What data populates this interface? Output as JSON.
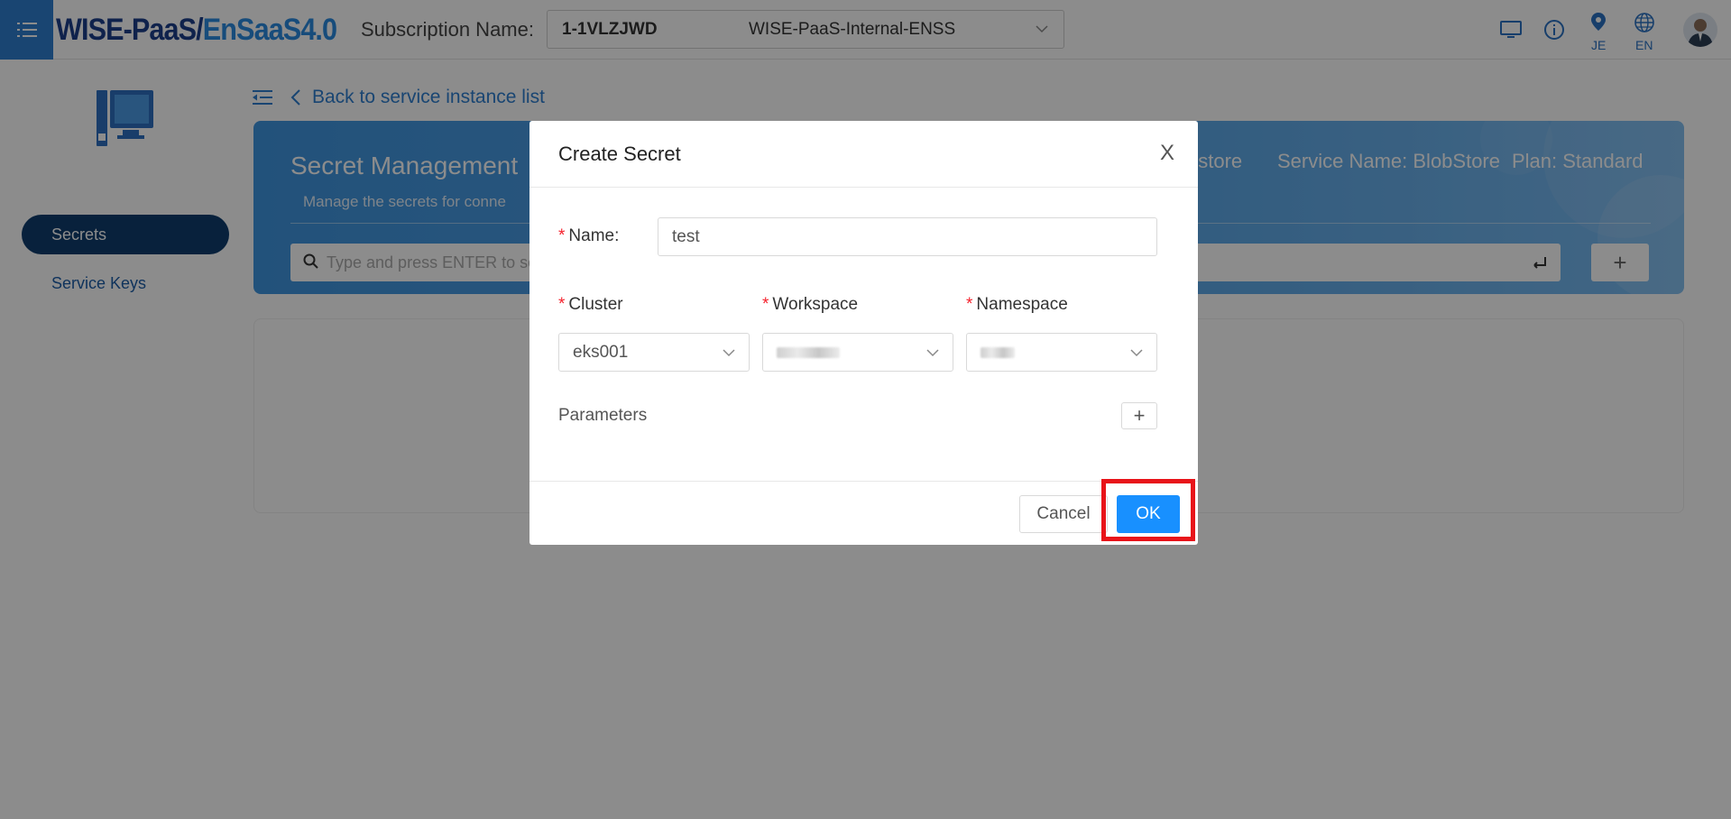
{
  "header": {
    "logo_part1": "WISE-PaaS/",
    "logo_part2": "EnSaaS4.0",
    "subscription_label": "Subscription Name:",
    "subscription_id": "1-1VLZJWD",
    "subscription_name": "WISE-PaaS-Internal-ENSS",
    "location_label": "JE",
    "language_label": "EN"
  },
  "sidebar": {
    "items": [
      {
        "label": "Secrets",
        "active": true
      },
      {
        "label": "Service Keys",
        "active": false
      }
    ]
  },
  "main": {
    "back_link": "Back to service instance list",
    "banner": {
      "title": "Secret Management",
      "description": "Manage the secrets for conne",
      "service_fragment": "bstore",
      "service_name": "Service Name: BlobStore",
      "plan": "Plan: Standard",
      "search_placeholder": "Type and press ENTER to se",
      "add_label": "+"
    }
  },
  "modal": {
    "title": "Create Secret",
    "close_label": "X",
    "name_label": "Name:",
    "name_value": "test",
    "cluster_label": "Cluster",
    "cluster_value": "eks001",
    "workspace_label": "Workspace",
    "namespace_label": "Namespace",
    "parameters_label": "Parameters",
    "parameters_add_label": "+",
    "cancel_label": "Cancel",
    "ok_label": "OK",
    "required_mark": "*"
  },
  "colors": {
    "accent": "#1890ff",
    "sidebar_active": "#0f3d6e",
    "highlight": "#e8141a"
  }
}
